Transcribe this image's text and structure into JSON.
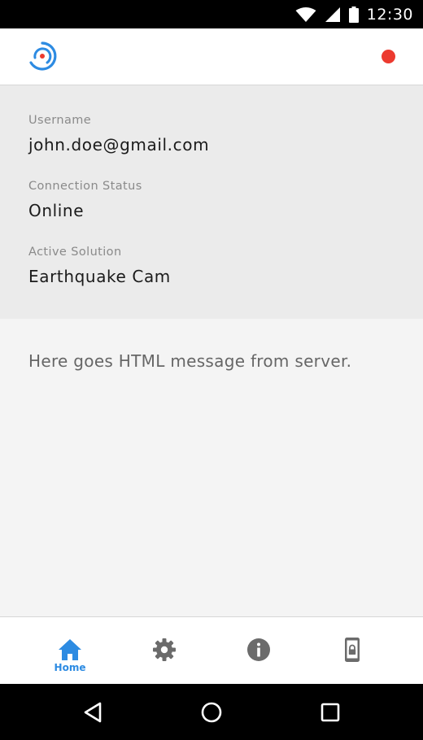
{
  "status_bar": {
    "time": "12:30"
  },
  "app_bar": {
    "logo_icon": "target-logo-icon",
    "recording_indicator_color": "#ec3a2f"
  },
  "info": {
    "username": {
      "label": "Username",
      "value": "john.doe@gmail.com"
    },
    "connection": {
      "label": "Connection Status",
      "value": "Online"
    },
    "solution": {
      "label": "Active Solution",
      "value": "Earthquake Cam"
    }
  },
  "message": "Here goes HTML message from server.",
  "bottom_nav": {
    "items": [
      {
        "icon": "home-icon",
        "label": "Home",
        "active": true
      },
      {
        "icon": "gear-icon",
        "label": "",
        "active": false
      },
      {
        "icon": "info-icon",
        "label": "",
        "active": false
      },
      {
        "icon": "phone-lock-icon",
        "label": "",
        "active": false
      }
    ],
    "active_color": "#2d8be2",
    "inactive_color": "#6b6b6b"
  },
  "system_nav": {
    "buttons": [
      "back-icon",
      "home-circle-icon",
      "recents-icon"
    ]
  }
}
